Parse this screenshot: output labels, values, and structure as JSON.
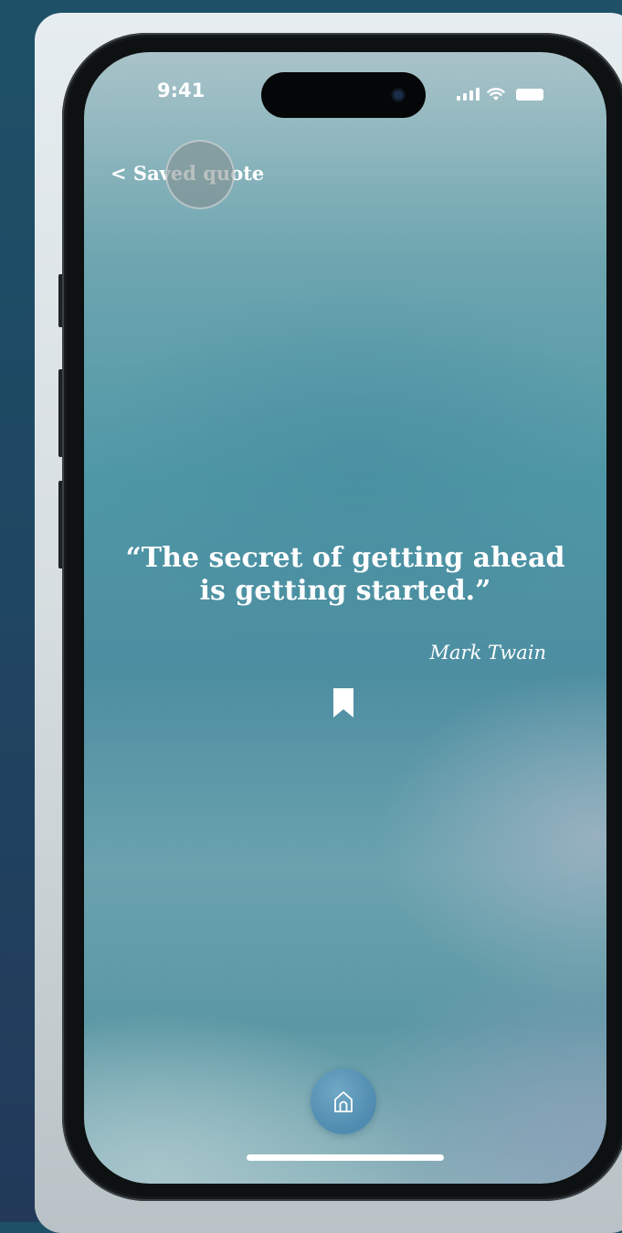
{
  "status_bar": {
    "time": "9:41",
    "icons": [
      "cellular-signal-icon",
      "wifi-icon",
      "battery-icon"
    ]
  },
  "nav": {
    "back_label": "< Saved quote"
  },
  "quote": {
    "text": "“The secret of getting ahead is getting started.”",
    "author": "Mark Twain",
    "bookmark_icon": "bookmark-icon"
  },
  "tab_bar": {
    "home_icon": "home-icon"
  },
  "colors": {
    "text": "#ffffff",
    "home_button": "#5b95b8"
  }
}
